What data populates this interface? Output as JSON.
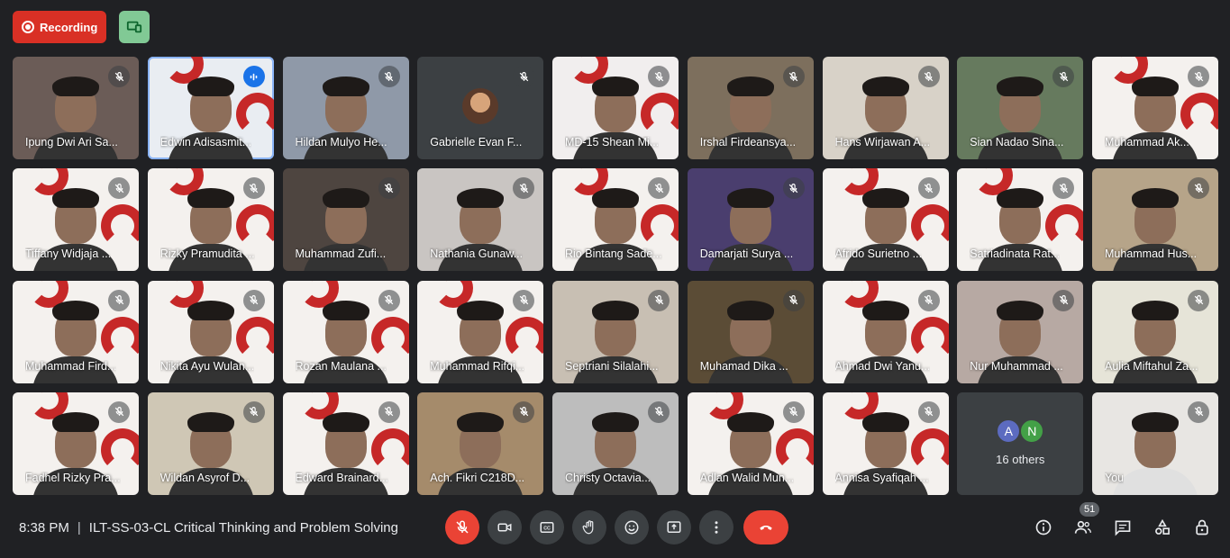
{
  "topbar": {
    "recording_label": "Recording"
  },
  "participants": [
    {
      "name": "Ipung Dwi Ari Sa...",
      "bg": "#6b5c57",
      "logo": false,
      "active": false
    },
    {
      "name": "Edwin Adisasmit...",
      "bg": "#e9edf2",
      "logo": true,
      "active": true
    },
    {
      "name": "Hildan Mulyo He...",
      "bg": "#8f99a8",
      "logo": false,
      "active": false
    },
    {
      "name": "Gabrielle Evan F...",
      "bg": "#3c4043",
      "avatar": true,
      "active": false
    },
    {
      "name": "MD-15 Shean Mi...",
      "bg": "#f1eeee",
      "logo": true,
      "active": false
    },
    {
      "name": "Irshal Firdeansya...",
      "bg": "#7d6f5d",
      "logo": false,
      "active": false
    },
    {
      "name": "Hans Wirjawan A...",
      "bg": "#d8d2c8",
      "logo": false,
      "active": false
    },
    {
      "name": "Sian Nadao Sina...",
      "bg": "#667a5e",
      "logo": false,
      "active": false
    },
    {
      "name": "Muhammad Ak...",
      "bg": "#f4f1ee",
      "logo": true,
      "active": false
    },
    {
      "name": "Tiffany Widjaja ...",
      "bg": "#f4f1ee",
      "logo": true,
      "active": false
    },
    {
      "name": "Rizky Pramudita ...",
      "bg": "#f4f1ee",
      "logo": true,
      "active": false
    },
    {
      "name": "Muhammad Zufi...",
      "bg": "#4e4540",
      "logo": false,
      "active": false
    },
    {
      "name": "Nathania Gunaw...",
      "bg": "#c9c5c2",
      "logo": false,
      "active": false
    },
    {
      "name": "Rio Bintang Sade...",
      "bg": "#f4f1ee",
      "logo": true,
      "active": false
    },
    {
      "name": "Damarjati Surya ...",
      "bg": "#4a3e6e",
      "logo": false,
      "active": false
    },
    {
      "name": "Afrido Surietno ...",
      "bg": "#f4f1ee",
      "logo": true,
      "active": false
    },
    {
      "name": "Satriadinata Rat...",
      "bg": "#f4f1ee",
      "logo": true,
      "active": false
    },
    {
      "name": "Muhammad Hus...",
      "bg": "#b6a489",
      "logo": false,
      "active": false
    },
    {
      "name": "Muhammad Fird...",
      "bg": "#f4f1ee",
      "logo": true,
      "active": false
    },
    {
      "name": "Nikita Ayu Wulan...",
      "bg": "#f4f1ee",
      "logo": true,
      "active": false
    },
    {
      "name": "Rozan Maulana ...",
      "bg": "#f4f1ee",
      "logo": true,
      "active": false
    },
    {
      "name": "Muhammad Rifqi...",
      "bg": "#f4f1ee",
      "logo": true,
      "active": false
    },
    {
      "name": "Septriani Silalahi...",
      "bg": "#c8bfb3",
      "logo": false,
      "active": false
    },
    {
      "name": "Muhamad Dika ...",
      "bg": "#5b4c36",
      "logo": false,
      "active": false
    },
    {
      "name": "Ahmad Dwi Yanu...",
      "bg": "#f4f1ee",
      "logo": true,
      "active": false
    },
    {
      "name": "Nur Muhammad ...",
      "bg": "#b7a9a3",
      "logo": false,
      "active": false
    },
    {
      "name": "Aulia Miftahul Za...",
      "bg": "#e6e4d8",
      "logo": false,
      "active": false
    },
    {
      "name": "Fadhel Rizky Pra...",
      "bg": "#f4f1ee",
      "logo": true,
      "active": false
    },
    {
      "name": "Wildan Asyrof D...",
      "bg": "#cfc7b5",
      "logo": false,
      "active": false
    },
    {
      "name": "Edward Brainard...",
      "bg": "#f4f1ee",
      "logo": true,
      "active": false
    },
    {
      "name": "Ach. Fikri C218D...",
      "bg": "#a58b6b",
      "logo": false,
      "active": false
    },
    {
      "name": "Christy Octavia...",
      "bg": "#bdbdbd",
      "logo": false,
      "active": false
    },
    {
      "name": "Adlan Walid Mun...",
      "bg": "#f4f1ee",
      "logo": true,
      "active": false
    },
    {
      "name": "Annisa Syafiqah ...",
      "bg": "#f4f1ee",
      "logo": true,
      "active": false
    }
  ],
  "others": {
    "chip1": "A",
    "chip1_color": "#5c6bc0",
    "chip2": "N",
    "chip2_color": "#43a047",
    "label": "16 others"
  },
  "self": {
    "name": "You",
    "bg": "#e8e6e3"
  },
  "bottom": {
    "time": "8:38 PM",
    "separator": "|",
    "meeting_title": "ILT-SS-03-CL Critical Thinking and Problem Solving",
    "people_count": "51"
  }
}
